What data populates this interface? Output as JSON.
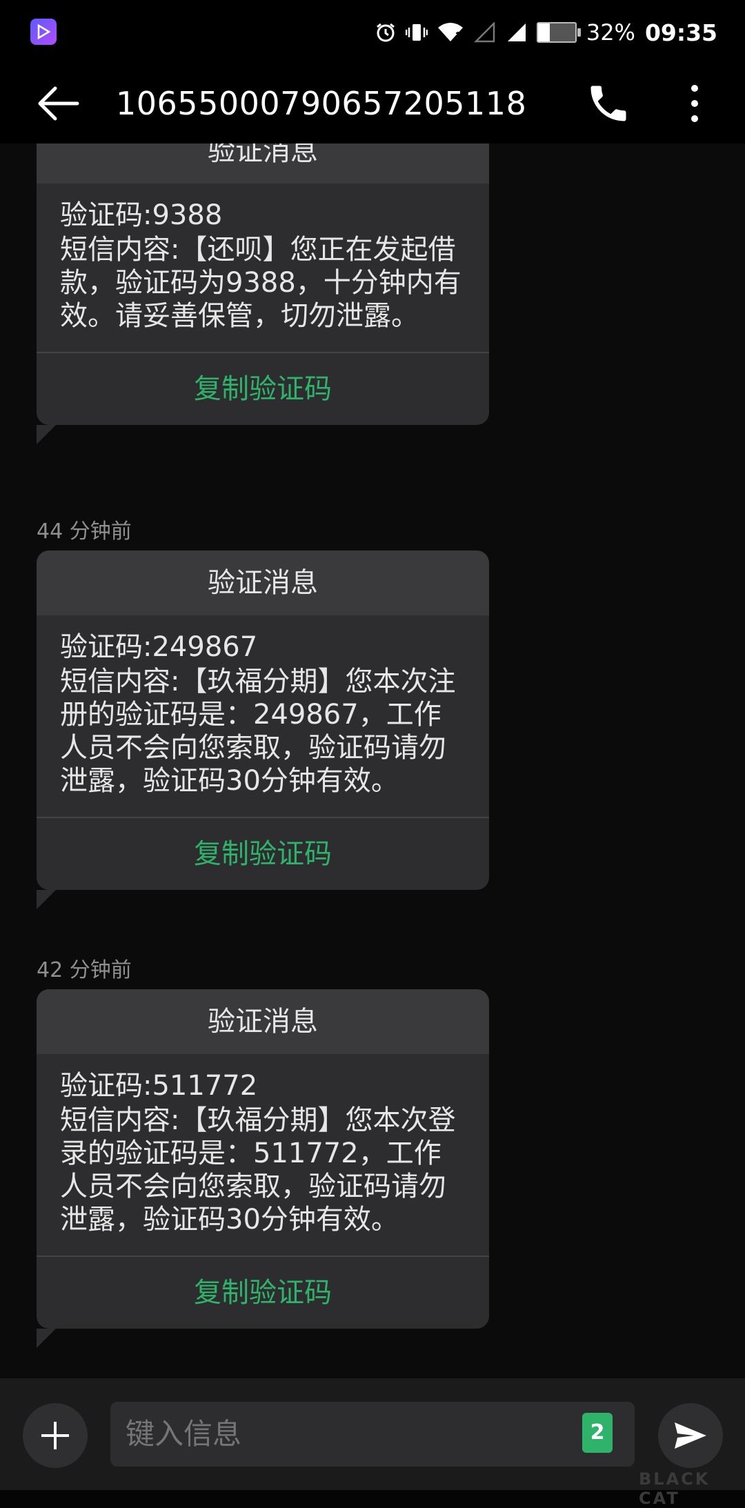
{
  "status_bar": {
    "battery": "32%",
    "battery_level": 0.32,
    "time": "09:35"
  },
  "header": {
    "title": "10655000790657205118"
  },
  "messages": [
    {
      "timestamp": "",
      "header": "验证消息",
      "code_line": "验证码:9388",
      "content": "短信内容:【还呗】您正在发起借款，验证码为9388，十分钟内有效。请妥善保管，切勿泄露。",
      "action": "复制验证码"
    },
    {
      "timestamp": "44 分钟前",
      "header": "验证消息",
      "code_line": "验证码:249867",
      "content": "短信内容:【玖福分期】您本次注册的验证码是：249867，工作人员不会向您索取，验证码请勿泄露，验证码30分钟有效。",
      "action": "复制验证码"
    },
    {
      "timestamp": "42 分钟前",
      "header": "验证消息",
      "code_line": "验证码:511772",
      "content": "短信内容:【玖福分期】您本次登录的验证码是：511772，工作人员不会向您索取，验证码请勿泄露，验证码30分钟有效。",
      "action": "复制验证码"
    }
  ],
  "input": {
    "placeholder": "键入信息",
    "sim_slot": "2"
  },
  "watermark": "BLACK CAT",
  "colors": {
    "accent_green": "#2fb36b",
    "card_bg": "#2d2d2f",
    "background": "#0b0b0b"
  }
}
